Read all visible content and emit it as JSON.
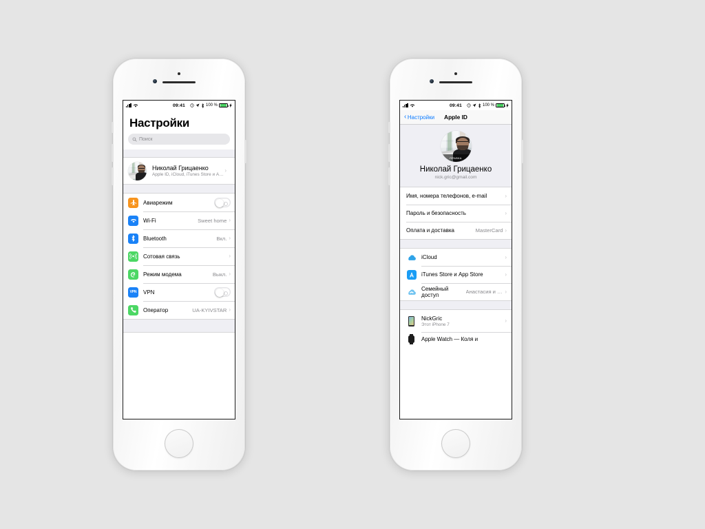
{
  "background_color": "#e5e5e5",
  "status_bar": {
    "time": "09:41",
    "battery_percent": "100 %",
    "icons": [
      "signal-bars-icon",
      "wifi-icon",
      "alarm-icon",
      "location-arrow-icon",
      "bluetooth-icon",
      "battery-icon",
      "charging-bolt-icon"
    ]
  },
  "phone_left": {
    "screen_title": "Настройки",
    "search": {
      "placeholder": "Поиск",
      "value": ""
    },
    "profile": {
      "name": "Николай Грицаенко",
      "subtitle": "Apple ID, iCloud, iTunes Store и App St..."
    },
    "rows": [
      {
        "icon": "airplane-icon",
        "icon_color": "#f7941e",
        "label": "Авиарежим",
        "value": "",
        "control": "toggle-off"
      },
      {
        "icon": "wifi-icon",
        "icon_color": "#1a82f7",
        "label": "Wi-Fi",
        "value": "Sweet home",
        "control": "chevron"
      },
      {
        "icon": "bluetooth-icon",
        "icon_color": "#1a82f7",
        "label": "Bluetooth",
        "value": "Вкл.",
        "control": "chevron"
      },
      {
        "icon": "cellular-icon",
        "icon_color": "#4cd764",
        "label": "Сотовая связь",
        "value": "",
        "control": "chevron"
      },
      {
        "icon": "hotspot-icon",
        "icon_color": "#4cd764",
        "label": "Режим модема",
        "value": "Выкл.",
        "control": "chevron"
      },
      {
        "icon": "vpn-icon",
        "icon_color": "#1a82f7",
        "label": "VPN",
        "value": "",
        "control": "toggle-off"
      },
      {
        "icon": "phone-icon",
        "icon_color": "#4cd764",
        "label": "Оператор",
        "value": "UA-KYIVSTAR",
        "control": "chevron"
      }
    ]
  },
  "phone_right": {
    "nav": {
      "back_label": "Настройки",
      "title": "Apple ID"
    },
    "hero": {
      "avatar_edit_label": "ПРАВКА",
      "name": "Николай Грицаенко",
      "email": "nick.gric@gmail.com"
    },
    "account_rows": [
      {
        "label": "Имя, номера телефонов, e-mail",
        "value": ""
      },
      {
        "label": "Пароль и безопасность",
        "value": ""
      },
      {
        "label": "Оплата и доставка",
        "value": "MasterCard"
      }
    ],
    "service_rows": [
      {
        "icon": "icloud-icon",
        "label": "iCloud",
        "value": ""
      },
      {
        "icon": "appstore-icon",
        "label": "iTunes Store и App Store",
        "value": ""
      },
      {
        "icon": "family-icon",
        "label": "Семейный доступ",
        "value": "Анастасия и Т..."
      }
    ],
    "device_rows": [
      {
        "icon": "iphone-icon",
        "name": "NickGric",
        "sub": "Этот iPhone 7"
      },
      {
        "icon": "applewatch-icon",
        "name": "Apple Watch — Коля и",
        "sub": ""
      }
    ]
  }
}
